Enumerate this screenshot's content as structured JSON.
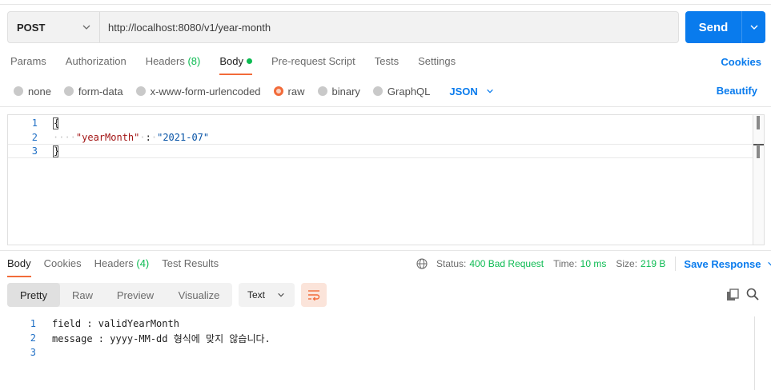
{
  "request": {
    "method": "POST",
    "url": "http://localhost:8080/v1/year-month",
    "send_label": "Send"
  },
  "req_tabs": [
    {
      "label": "Params"
    },
    {
      "label": "Authorization"
    },
    {
      "label": "Headers",
      "count": "(8)"
    },
    {
      "label": "Body",
      "active": true
    },
    {
      "label": "Pre-request Script"
    },
    {
      "label": "Tests"
    },
    {
      "label": "Settings"
    }
  ],
  "cookies_label": "Cookies",
  "body_types": [
    "none",
    "form-data",
    "x-www-form-urlencoded",
    "raw",
    "binary",
    "GraphQL"
  ],
  "body_type_selected": "raw",
  "language": "JSON",
  "beautify_label": "Beautify",
  "editor": {
    "lines": [
      {
        "n": "1",
        "open": "{"
      },
      {
        "n": "2",
        "key": "\"yearMonth\"",
        "colon": ":",
        "value": "\"2021-07\""
      },
      {
        "n": "3",
        "close": "}"
      }
    ]
  },
  "response": {
    "tabs": [
      {
        "label": "Body",
        "active": true
      },
      {
        "label": "Cookies"
      },
      {
        "label": "Headers",
        "count": "(4)"
      },
      {
        "label": "Test Results"
      }
    ],
    "status_label": "Status:",
    "status_value": "400 Bad Request",
    "time_label": "Time:",
    "time_value": "10 ms",
    "size_label": "Size:",
    "size_value": "219 B",
    "save_label": "Save Response",
    "views": [
      "Pretty",
      "Raw",
      "Preview",
      "Visualize"
    ],
    "view_active": "Pretty",
    "format": "Text",
    "body_lines": [
      {
        "n": "1",
        "text": "field : validYearMonth"
      },
      {
        "n": "2",
        "text": "message : yyyy-MM-dd 형식에 맞지 않습니다."
      },
      {
        "n": "3",
        "text": ""
      }
    ]
  },
  "colors": {
    "accent": "#097bed",
    "active_tab": "#f26b3a",
    "count_green": "#0cbb52"
  }
}
